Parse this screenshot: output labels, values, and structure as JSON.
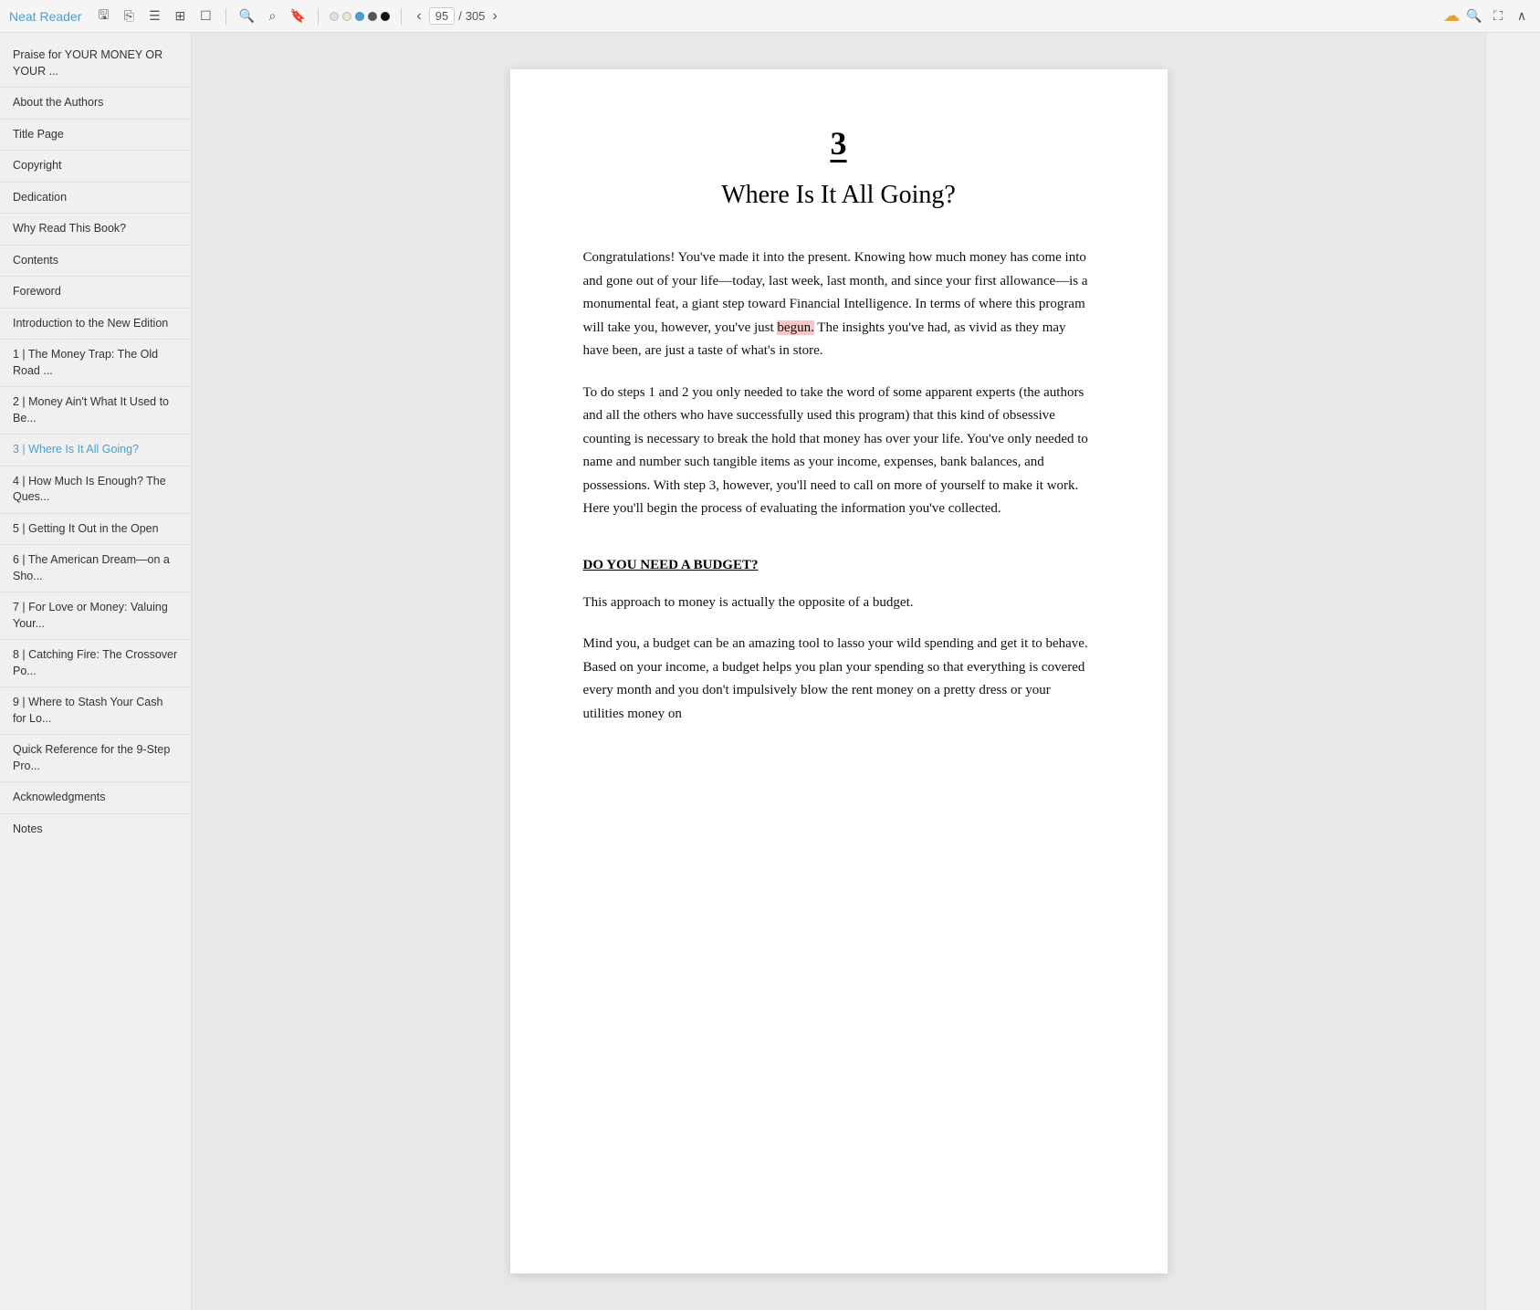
{
  "app": {
    "title": "Neat Reader",
    "icon": "📖"
  },
  "toolbar": {
    "current_page": "95",
    "total_pages": "305",
    "dot_colors": [
      "#e0e0e0",
      "#e0e0e0",
      "#4a9fd4",
      "#333",
      "#111"
    ]
  },
  "sidebar": {
    "items": [
      {
        "id": "praise",
        "label": "Praise for YOUR MONEY OR YOUR ...",
        "active": false
      },
      {
        "id": "about-authors",
        "label": "About the Authors",
        "active": false
      },
      {
        "id": "title-page",
        "label": "Title Page",
        "active": false
      },
      {
        "id": "copyright",
        "label": "Copyright",
        "active": false
      },
      {
        "id": "dedication",
        "label": "Dedication",
        "active": false
      },
      {
        "id": "why-read",
        "label": "Why Read This Book?",
        "active": false
      },
      {
        "id": "contents",
        "label": "Contents",
        "active": false
      },
      {
        "id": "foreword",
        "label": "Foreword",
        "active": false
      },
      {
        "id": "introduction",
        "label": "Introduction to the New Edition",
        "active": false
      },
      {
        "id": "ch1",
        "label": "1 | The Money Trap: The Old Road ...",
        "active": false
      },
      {
        "id": "ch2",
        "label": "2 | Money Ain't What It Used to Be...",
        "active": false
      },
      {
        "id": "ch3",
        "label": "3 | Where Is It All Going?",
        "active": true
      },
      {
        "id": "ch4",
        "label": "4 | How Much Is Enough? The Ques...",
        "active": false
      },
      {
        "id": "ch5",
        "label": "5 | Getting It Out in the Open",
        "active": false
      },
      {
        "id": "ch6",
        "label": "6 | The American Dream—on a Sho...",
        "active": false
      },
      {
        "id": "ch7",
        "label": "7 | For Love or Money: Valuing Your...",
        "active": false
      },
      {
        "id": "ch8",
        "label": "8 | Catching Fire: The Crossover Po...",
        "active": false
      },
      {
        "id": "ch9",
        "label": "9 | Where to Stash Your Cash for Lo...",
        "active": false
      },
      {
        "id": "quick-ref",
        "label": "Quick Reference for the 9-Step Pro...",
        "active": false
      },
      {
        "id": "acknowledgments",
        "label": "Acknowledgments",
        "active": false
      },
      {
        "id": "notes",
        "label": "Notes",
        "active": false
      }
    ]
  },
  "book": {
    "chapter_number": "3",
    "chapter_title": "Where Is It All Going?",
    "section_heading": "DO YOU NEED A BUDGET?",
    "paragraphs": [
      "Congratulations! You've made it into the present. Knowing how much money has come into and gone out of your life—today, last week, last month, and since your first allowance—is a monumental feat, a giant step toward Financial Intelligence. In terms of where this program will take you, however, you've just begun. The insights you've had, as vivid as they may have been, are just a taste of what's in store.",
      "To do steps 1 and 2 you only needed to take the word of some apparent experts (the authors and all the others who have successfully used this program) that this kind of obsessive counting is necessary to break the hold that money has over your life. You've only needed to name and number such tangible items as your income, expenses, bank balances, and possessions. With step 3, however, you'll need to call on more of yourself to make it work. Here you'll begin the process of evaluating the information you've collected.",
      "This approach to money is actually the opposite of a budget.",
      "Mind you, a budget can be an amazing tool to lasso your wild spending and get it to behave. Based on your income, a budget helps you plan your spending so that everything is covered every month and you don't impulsively blow the rent money on a pretty dress or your utilities money on"
    ],
    "highlighted_word": "begun."
  }
}
